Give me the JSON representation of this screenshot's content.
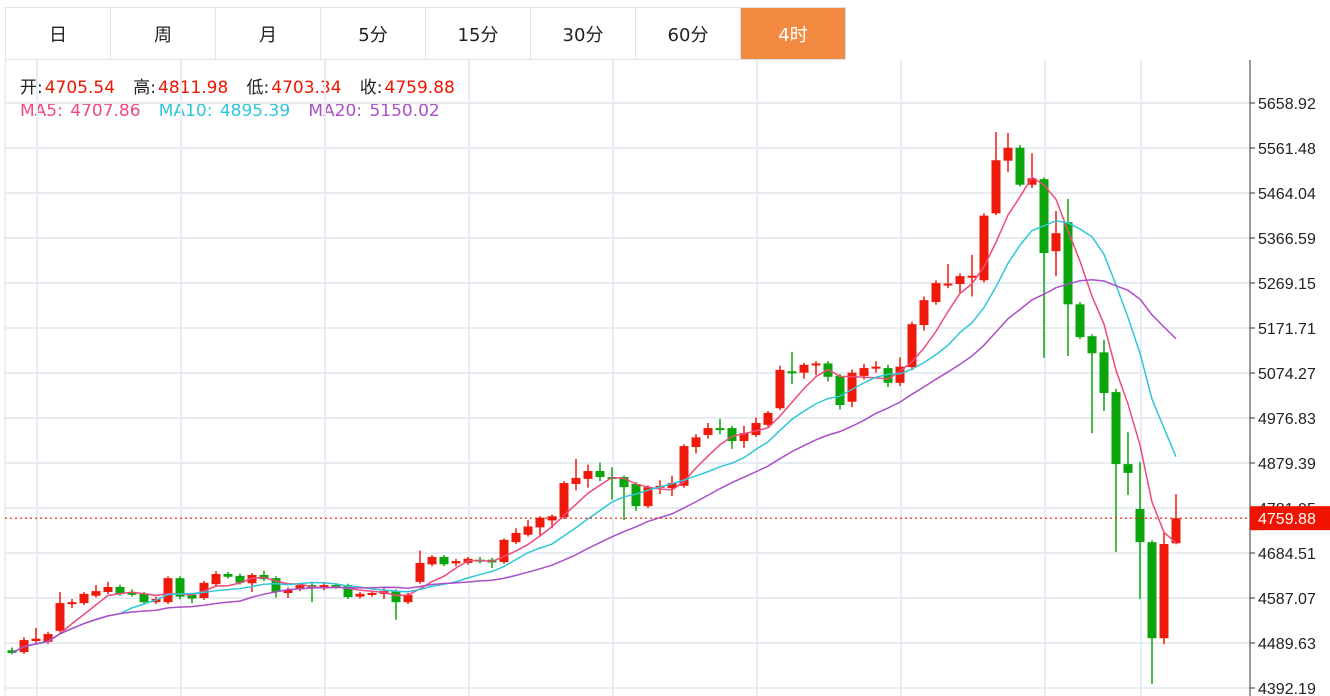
{
  "tabs": [
    {
      "label": "日",
      "active": false
    },
    {
      "label": "周",
      "active": false
    },
    {
      "label": "月",
      "active": false
    },
    {
      "label": "5分",
      "active": false
    },
    {
      "label": "15分",
      "active": false
    },
    {
      "label": "30分",
      "active": false
    },
    {
      "label": "60分",
      "active": false
    },
    {
      "label": "4时",
      "active": true
    }
  ],
  "ohlc_info": {
    "open_label": "开:",
    "open": "4705.54",
    "high_label": "高:",
    "high": "4811.98",
    "low_label": "低:",
    "low": "4703.34",
    "close_label": "收:",
    "close": "4759.88"
  },
  "ma_info": {
    "ma5_label": "MA5:",
    "ma5": "4707.86",
    "ma10_label": "MA10:",
    "ma10": "4895.39",
    "ma20_label": "MA20:",
    "ma20": "5150.02"
  },
  "colors": {
    "up": "#f01a0a",
    "down": "#0aa50a",
    "ma5": "#ee4a7e",
    "ma10": "#2ec7da",
    "ma20": "#ab4ec8",
    "active_tab": "#f38a41"
  },
  "chart_data": {
    "type": "candlestick",
    "y_ticks": [
      "5658.92",
      "5561.48",
      "5464.04",
      "5366.59",
      "5269.15",
      "5171.71",
      "5074.27",
      "4976.83",
      "4879.39",
      "4781.95",
      "4684.51",
      "4587.07",
      "4489.63",
      "4392.19"
    ],
    "ylim": [
      4392.19,
      5658.92
    ],
    "last_price": "4759.88",
    "candles": [
      [
        4474,
        4480,
        4465,
        4468
      ],
      [
        4470,
        4502,
        4466,
        4496
      ],
      [
        4494,
        4522,
        4490,
        4499
      ],
      [
        4492,
        4514,
        4488,
        4509
      ],
      [
        4516,
        4600,
        4512,
        4576
      ],
      [
        4574,
        4585,
        4565,
        4578
      ],
      [
        4576,
        4600,
        4572,
        4596
      ],
      [
        4592,
        4615,
        4588,
        4602
      ],
      [
        4600,
        4622,
        4596,
        4611
      ],
      [
        4611,
        4616,
        4592,
        4596
      ],
      [
        4600,
        4606,
        4590,
        4594
      ],
      [
        4596,
        4600,
        4575,
        4578
      ],
      [
        4578,
        4590,
        4574,
        4585
      ],
      [
        4578,
        4634,
        4574,
        4630
      ],
      [
        4630,
        4634,
        4584,
        4590
      ],
      [
        4594,
        4598,
        4576,
        4586
      ],
      [
        4587,
        4624,
        4583,
        4620
      ],
      [
        4617,
        4645,
        4613,
        4639
      ],
      [
        4639,
        4644,
        4629,
        4633
      ],
      [
        4635,
        4640,
        4616,
        4620
      ],
      [
        4619,
        4641,
        4600,
        4637
      ],
      [
        4637,
        4646,
        4624,
        4628
      ],
      [
        4630,
        4634,
        4588,
        4600
      ],
      [
        4598,
        4610,
        4587,
        4605
      ],
      [
        4606,
        4620,
        4602,
        4615
      ],
      [
        4615,
        4619,
        4578,
        4609
      ],
      [
        4608,
        4619,
        4604,
        4615
      ],
      [
        4615,
        4619,
        4607,
        4611
      ],
      [
        4615,
        4618,
        4585,
        4589
      ],
      [
        4590,
        4600,
        4586,
        4596
      ],
      [
        4594,
        4602,
        4590,
        4598
      ],
      [
        4596,
        4612,
        4585,
        4602
      ],
      [
        4602,
        4606,
        4540,
        4578
      ],
      [
        4578,
        4598,
        4574,
        4594
      ],
      [
        4622,
        4690,
        4618,
        4663
      ],
      [
        4660,
        4680,
        4656,
        4676
      ],
      [
        4676,
        4680,
        4656,
        4660
      ],
      [
        4662,
        4672,
        4656,
        4667
      ],
      [
        4663,
        4676,
        4659,
        4672
      ],
      [
        4670,
        4676,
        4662,
        4668
      ],
      [
        4670,
        4674,
        4652,
        4664
      ],
      [
        4665,
        4716,
        4661,
        4713
      ],
      [
        4708,
        4738,
        4704,
        4728
      ],
      [
        4724,
        4756,
        4720,
        4742
      ],
      [
        4740,
        4764,
        4720,
        4761
      ],
      [
        4755,
        4768,
        4738,
        4764
      ],
      [
        4762,
        4840,
        4758,
        4836
      ],
      [
        4834,
        4888,
        4820,
        4847
      ],
      [
        4845,
        4876,
        4826,
        4862
      ],
      [
        4862,
        4880,
        4840,
        4849
      ],
      [
        4849,
        4870,
        4800,
        4846
      ],
      [
        4849,
        4852,
        4756,
        4827
      ],
      [
        4834,
        4838,
        4776,
        4786
      ],
      [
        4786,
        4831,
        4782,
        4827
      ],
      [
        4827,
        4842,
        4812,
        4830
      ],
      [
        4825,
        4852,
        4808,
        4836
      ],
      [
        4830,
        4920,
        4826,
        4916
      ],
      [
        4914,
        4942,
        4900,
        4935
      ],
      [
        4940,
        4966,
        4932,
        4955
      ],
      [
        4955,
        4975,
        4942,
        4953
      ],
      [
        4955,
        4960,
        4910,
        4927
      ],
      [
        4927,
        4960,
        4912,
        4944
      ],
      [
        4940,
        4978,
        4936,
        4966
      ],
      [
        4962,
        4992,
        4958,
        4988
      ],
      [
        4998,
        5090,
        4994,
        5081
      ],
      [
        5078,
        5120,
        5050,
        5076
      ],
      [
        5075,
        5096,
        5062,
        5092
      ],
      [
        5092,
        5100,
        5070,
        5095
      ],
      [
        5095,
        5100,
        5056,
        5066
      ],
      [
        5068,
        5072,
        4995,
        5005
      ],
      [
        5012,
        5082,
        5000,
        5075
      ],
      [
        5068,
        5094,
        5060,
        5085
      ],
      [
        5086,
        5100,
        5075,
        5088
      ],
      [
        5085,
        5092,
        5044,
        5053
      ],
      [
        5053,
        5108,
        5046,
        5088
      ],
      [
        5087,
        5185,
        5080,
        5180
      ],
      [
        5178,
        5240,
        5166,
        5232
      ],
      [
        5228,
        5275,
        5222,
        5269
      ],
      [
        5266,
        5310,
        5258,
        5268
      ],
      [
        5267,
        5290,
        5245,
        5284
      ],
      [
        5282,
        5330,
        5240,
        5285
      ],
      [
        5275,
        5420,
        5270,
        5415
      ],
      [
        5420,
        5596,
        5416,
        5535
      ],
      [
        5534,
        5594,
        5510,
        5562
      ],
      [
        5562,
        5568,
        5478,
        5482
      ],
      [
        5482,
        5550,
        5475,
        5496
      ],
      [
        5494,
        5498,
        5107,
        5334
      ],
      [
        5338,
        5425,
        5284,
        5377
      ],
      [
        5401,
        5451,
        5111,
        5223
      ],
      [
        5223,
        5228,
        5148,
        5152
      ],
      [
        5154,
        5158,
        4944,
        5117
      ],
      [
        5119,
        5146,
        4992,
        5031
      ],
      [
        5033,
        5040,
        4687,
        4877
      ],
      [
        4877,
        4946,
        4810,
        4858
      ],
      [
        4780,
        4881,
        4585,
        4708
      ],
      [
        4708,
        4712,
        4401,
        4500
      ],
      [
        4500,
        4728,
        4487,
        4704
      ],
      [
        4705.54,
        4811.98,
        4703.34,
        4759.88
      ]
    ],
    "ma_periods": [
      5,
      10,
      20
    ]
  }
}
